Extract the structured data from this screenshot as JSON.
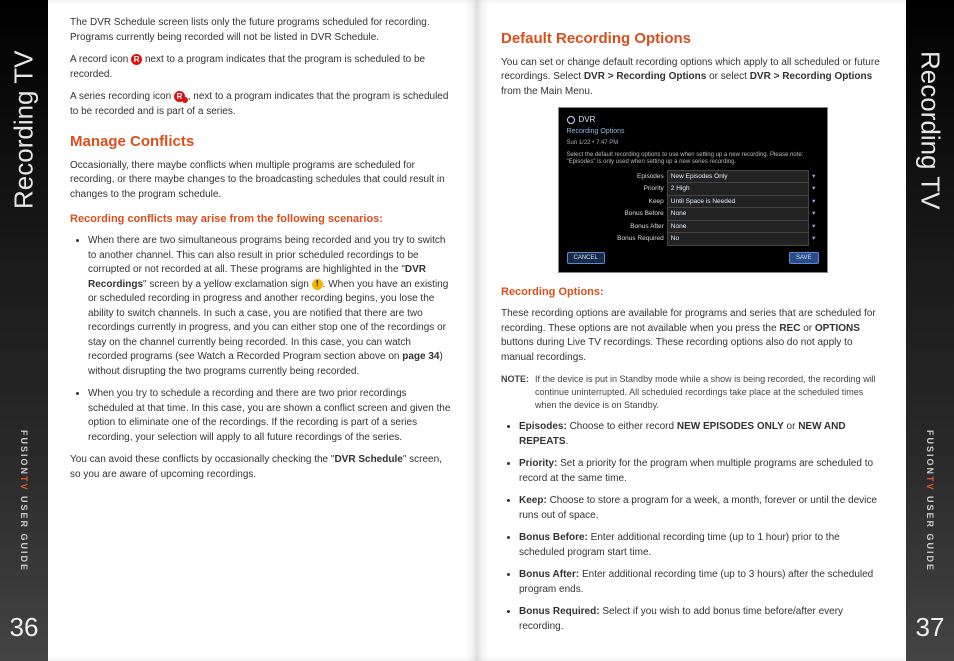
{
  "rail": {
    "tab_title": "Recording TV",
    "brand_prefix": "FUSION",
    "brand_accent": "TV",
    "brand_suffix": " USER GUIDE",
    "page_left": "36",
    "page_right": "37"
  },
  "left": {
    "intro1": "The DVR Schedule screen lists only the future programs scheduled for recording. Programs currently being recorded will not be listed in DVR Schedule.",
    "intro2a": "A record icon ",
    "intro2_icon": "R",
    "intro2b": " next to a program indicates that the program is scheduled to be recorded.",
    "intro3a": "A series recording icon ",
    "intro3_icon": "R",
    "intro3b": ", next to a program indicates that the program is scheduled to be recorded and is part of a series.",
    "h_conflicts": "Manage Conflicts",
    "conflicts_p": "Occasionally, there maybe conflicts when multiple programs are scheduled for recording, or there maybe changes to the broadcasting schedules that could result in changes to the program schedule.",
    "conflicts_sub": "Recording conflicts may arise from the following scenarios:",
    "bullet1a": "When there are two simultaneous programs being recorded and you try to switch to another channel.  This can also result in prior scheduled recordings to be corrupted or not recorded at all.  These programs are highlighted in the \"",
    "bullet1_strong1": "DVR Recordings",
    "bullet1b": "\" screen by a yellow exclamation sign ",
    "bullet1_icon": "!",
    "bullet1c": ".  When you have an existing or scheduled recording in progress and another recording begins, you lose the ability to switch channels. In such a case, you are notified that there are two recordings currently in progress, and you can either stop one of the recordings or stay on the channel currently being recorded. In this case, you can watch recorded programs (see Watch a Recorded Program section above on ",
    "bullet1_strong2": "page 34",
    "bullet1d": ") without disrupting the two programs currently being recorded.",
    "bullet2": "When you try to schedule a recording and there are two prior recordings scheduled at that time. In this case, you are shown a conflict screen and given the option to eliminate one of the recordings. If the recording is part of a series recording, your selection will apply to all future recordings of the series.",
    "avoid_a": "You can avoid these conflicts by occasionally checking the \"",
    "avoid_strong": "DVR Schedule",
    "avoid_b": "\" screen, so you are aware of upcoming recordings."
  },
  "right": {
    "h_default": "Default Recording Options",
    "default_p_a": "You can set or change default recording options which apply to all scheduled or future recordings.  Select ",
    "default_p_s1": "DVR >  Recording Options",
    "default_p_b": " or select ",
    "default_p_s2": "DVR > Recording Options",
    "default_p_c": " from the Main Menu.",
    "shot": {
      "title": "DVR",
      "subtitle": "Recording Options",
      "time": "Sun 1/22 • 7:47 PM",
      "desc": "Select the default recording options to use when setting up a new recording. Please note: \"Episodes\" is only used when setting up a new series recording.",
      "rows": [
        {
          "k": "Episodes",
          "v": "New Episodes Only"
        },
        {
          "k": "Priority",
          "v": "2 High"
        },
        {
          "k": "Keep",
          "v": "Until Space is Needed"
        },
        {
          "k": "Bonus Before",
          "v": "None"
        },
        {
          "k": "Bonus After",
          "v": "None"
        },
        {
          "k": "Bonus Required",
          "v": "No"
        }
      ],
      "btn_cancel": "CANCEL",
      "btn_save": "SAVE"
    },
    "h_recopts": "Recording Options:",
    "recopts_p_a": "These recording options are available for programs and series that are scheduled for recording. These options are not available when you press the ",
    "recopts_s1": "REC",
    "recopts_mid": " or ",
    "recopts_s2": "OPTIONS",
    "recopts_p_b": " buttons during Live TV recordings. These recording options also do not apply to manual recordings.",
    "note_label": "NOTE:",
    "note_text": "If the device is put in Standby mode while a show is being recorded, the recording will continue uninterrupted.  All scheduled recordings take place at the scheduled times when the device is on Standby.",
    "opts": [
      {
        "k": "Episodes:",
        "pre": " Choose to either record ",
        "s1": "NEW EPISODES ONLY",
        "mid": " or ",
        "s2": "NEW AND REPEATS",
        "post": "."
      },
      {
        "k": "Priority:",
        "txt": " Set a priority for the program when multiple programs are scheduled to record at the same time."
      },
      {
        "k": "Keep:",
        "txt": " Choose to store a program for a week, a month, forever or until the device runs out of space."
      },
      {
        "k": "Bonus Before:",
        "txt": " Enter additional recording time (up to 1 hour) prior to the scheduled program start time."
      },
      {
        "k": "Bonus After:",
        "txt": " Enter additional recording time (up to 3 hours) after the scheduled program ends."
      },
      {
        "k": "Bonus Required:",
        "txt": " Select if you wish to add bonus time before/after every recording."
      }
    ]
  }
}
